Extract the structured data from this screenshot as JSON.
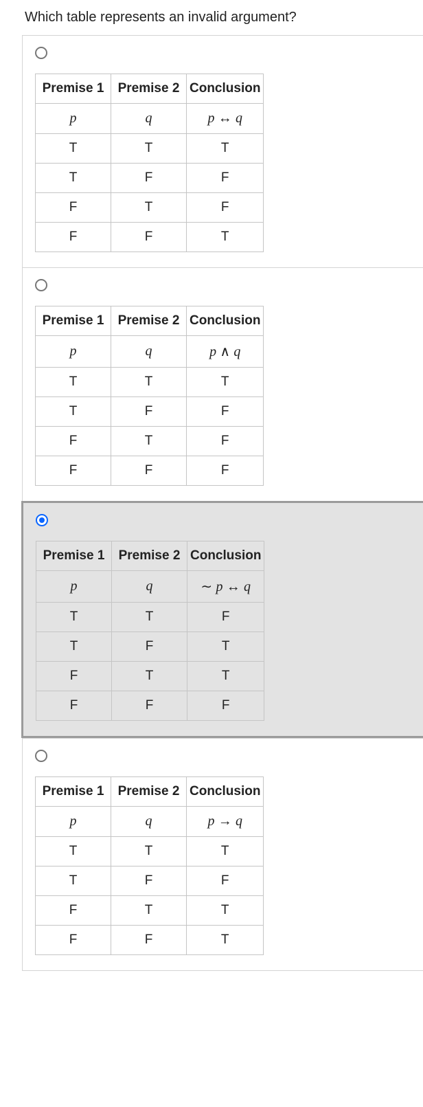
{
  "question": "Which table represents an invalid argument?",
  "headers": {
    "p1": "Premise 1",
    "p2": "Premise 2",
    "c": "Conclusion"
  },
  "options": [
    {
      "selected": false,
      "exprs": {
        "p1": "p",
        "p2": "q",
        "c": "p ↔ q"
      },
      "rows": [
        [
          "T",
          "T",
          "T"
        ],
        [
          "T",
          "F",
          "F"
        ],
        [
          "F",
          "T",
          "F"
        ],
        [
          "F",
          "F",
          "T"
        ]
      ]
    },
    {
      "selected": false,
      "exprs": {
        "p1": "p",
        "p2": "q",
        "c": "p ∧ q"
      },
      "rows": [
        [
          "T",
          "T",
          "T"
        ],
        [
          "T",
          "F",
          "F"
        ],
        [
          "F",
          "T",
          "F"
        ],
        [
          "F",
          "F",
          "F"
        ]
      ]
    },
    {
      "selected": true,
      "exprs": {
        "p1": "p",
        "p2": "q",
        "c": "∼ p ↔ q"
      },
      "rows": [
        [
          "T",
          "T",
          "F"
        ],
        [
          "T",
          "F",
          "T"
        ],
        [
          "F",
          "T",
          "T"
        ],
        [
          "F",
          "F",
          "F"
        ]
      ]
    },
    {
      "selected": false,
      "exprs": {
        "p1": "p",
        "p2": "q",
        "c": "p → q"
      },
      "rows": [
        [
          "T",
          "T",
          "T"
        ],
        [
          "T",
          "F",
          "F"
        ],
        [
          "F",
          "T",
          "T"
        ],
        [
          "F",
          "F",
          "T"
        ]
      ]
    }
  ]
}
